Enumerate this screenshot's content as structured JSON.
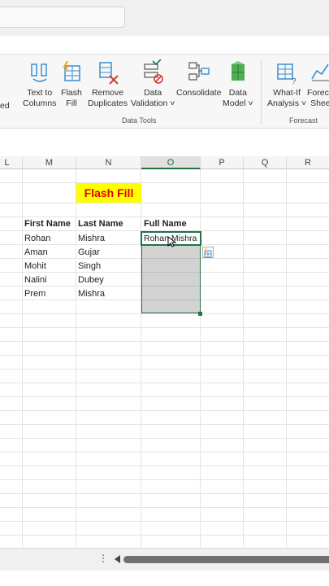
{
  "ribbon": {
    "partial_label": "ed",
    "buttons": [
      {
        "label1": "Text to",
        "label2": "Columns"
      },
      {
        "label1": "Flash",
        "label2": "Fill"
      },
      {
        "label1": "Remove",
        "label2": "Duplicates"
      },
      {
        "label1": "Data",
        "label2": "Validation ˅"
      },
      {
        "label1": "Consolidate",
        "label2": ""
      },
      {
        "label1": "Data",
        "label2": "Model ˅"
      },
      {
        "label1": "What-If",
        "label2": "Analysis ˅"
      },
      {
        "label1": "Foreca",
        "label2": "Shee"
      }
    ],
    "groups": {
      "data_tools": "Data Tools",
      "forecast": "Forecast"
    }
  },
  "columns": [
    "L",
    "M",
    "N",
    "O",
    "P",
    "Q",
    "R"
  ],
  "sheet": {
    "title": "Flash Fill",
    "headers": {
      "first": "First Name",
      "last": "Last Name",
      "full": "Full Name"
    },
    "rows": [
      {
        "first": "Rohan",
        "last": "Mishra",
        "full": "Rohan Mishra"
      },
      {
        "first": "Aman",
        "last": "Gujar",
        "full": ""
      },
      {
        "first": "Mohit",
        "last": "Singh",
        "full": ""
      },
      {
        "first": "Nalini",
        "last": "Dubey",
        "full": ""
      },
      {
        "first": "Prem",
        "last": "Mishra",
        "full": ""
      }
    ]
  },
  "bottom": {
    "more": "⋮"
  },
  "colors": {
    "accent": "#217346",
    "title_fill": "#ffff00",
    "title_text": "#e00000"
  }
}
